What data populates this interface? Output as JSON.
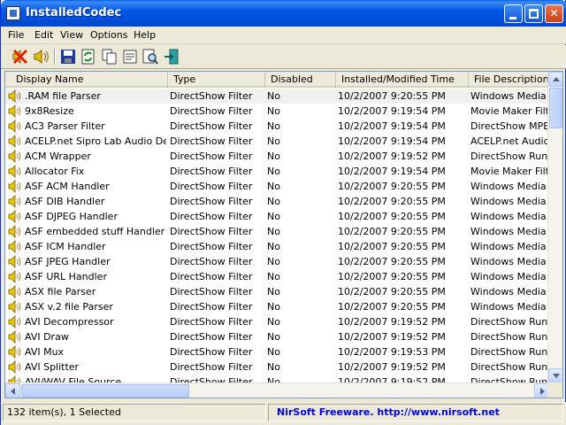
{
  "window": {
    "title": "InstalledCodec"
  },
  "menu": [
    "File",
    "Edit",
    "View",
    "Options",
    "Help"
  ],
  "toolbar": [
    "disable-icon",
    "enable-icon",
    "save-icon",
    "refresh-icon",
    "copy-icon",
    "properties-icon",
    "find-icon",
    "exit-icon"
  ],
  "columns": [
    "Display Name",
    "Type",
    "Disabled",
    "Installed/Modified Time",
    "File Description"
  ],
  "rows": [
    {
      "name": ".RAM file Parser",
      "type": "DirectShow Filter",
      "disabled": "No",
      "time": "10/2/2007 9:20:55 PM",
      "desc": "Windows Media File"
    },
    {
      "name": "9x8Resize",
      "type": "DirectShow Filter",
      "disabled": "No",
      "time": "10/2/2007 9:19:54 PM",
      "desc": "Movie Maker Filter"
    },
    {
      "name": "AC3 Parser Filter",
      "type": "DirectShow Filter",
      "disabled": "No",
      "time": "10/2/2007 9:19:54 PM",
      "desc": "DirectShow MPEG-"
    },
    {
      "name": "ACELP.net Sipro Lab Audio De...",
      "type": "DirectShow Filter",
      "disabled": "No",
      "time": "10/2/2007 9:19:54 PM",
      "desc": "ACELP.net Audio D"
    },
    {
      "name": "ACM Wrapper",
      "type": "DirectShow Filter",
      "disabled": "No",
      "time": "10/2/2007 9:19:52 PM",
      "desc": "DirectShow Runtim"
    },
    {
      "name": "Allocator Fix",
      "type": "DirectShow Filter",
      "disabled": "No",
      "time": "10/2/2007 9:19:54 PM",
      "desc": "Movie Maker Filter"
    },
    {
      "name": "ASF ACM Handler",
      "type": "DirectShow Filter",
      "disabled": "No",
      "time": "10/2/2007 9:20:55 PM",
      "desc": "Windows Media Fil"
    },
    {
      "name": "ASF DIB Handler",
      "type": "DirectShow Filter",
      "disabled": "No",
      "time": "10/2/2007 9:20:55 PM",
      "desc": "Windows Media Fil"
    },
    {
      "name": "ASF DJPEG Handler",
      "type": "DirectShow Filter",
      "disabled": "No",
      "time": "10/2/2007 9:20:55 PM",
      "desc": "Windows Media Fil"
    },
    {
      "name": "ASF embedded stuff Handler",
      "type": "DirectShow Filter",
      "disabled": "No",
      "time": "10/2/2007 9:20:55 PM",
      "desc": "Windows Media Fil"
    },
    {
      "name": "ASF ICM Handler",
      "type": "DirectShow Filter",
      "disabled": "No",
      "time": "10/2/2007 9:20:55 PM",
      "desc": "Windows Media Fil"
    },
    {
      "name": "ASF JPEG Handler",
      "type": "DirectShow Filter",
      "disabled": "No",
      "time": "10/2/2007 9:20:55 PM",
      "desc": "Windows Media Fil"
    },
    {
      "name": "ASF URL Handler",
      "type": "DirectShow Filter",
      "disabled": "No",
      "time": "10/2/2007 9:20:55 PM",
      "desc": "Windows Media Fil"
    },
    {
      "name": "ASX file Parser",
      "type": "DirectShow Filter",
      "disabled": "No",
      "time": "10/2/2007 9:20:55 PM",
      "desc": "Windows Media Fil"
    },
    {
      "name": "ASX v.2 file Parser",
      "type": "DirectShow Filter",
      "disabled": "No",
      "time": "10/2/2007 9:20:55 PM",
      "desc": "Windows Media Fil"
    },
    {
      "name": "AVI Decompressor",
      "type": "DirectShow Filter",
      "disabled": "No",
      "time": "10/2/2007 9:19:52 PM",
      "desc": "DirectShow Runtim"
    },
    {
      "name": "AVI Draw",
      "type": "DirectShow Filter",
      "disabled": "No",
      "time": "10/2/2007 9:19:52 PM",
      "desc": "DirectShow Runtim"
    },
    {
      "name": "AVI Mux",
      "type": "DirectShow Filter",
      "disabled": "No",
      "time": "10/2/2007 9:19:53 PM",
      "desc": "DirectShow Runtim"
    },
    {
      "name": "AVI Splitter",
      "type": "DirectShow Filter",
      "disabled": "No",
      "time": "10/2/2007 9:19:52 PM",
      "desc": "DirectShow Runtim"
    },
    {
      "name": "AVI/WAV File Source",
      "type": "DirectShow Filter",
      "disabled": "No",
      "time": "10/2/2007 9:19:52 PM",
      "desc": "DirectShow Runtim"
    }
  ],
  "selected_index": 0,
  "status": {
    "count": "132 item(s), 1 Selected",
    "brand": "NirSoft Freeware.  http://www.nirsoft.net"
  }
}
